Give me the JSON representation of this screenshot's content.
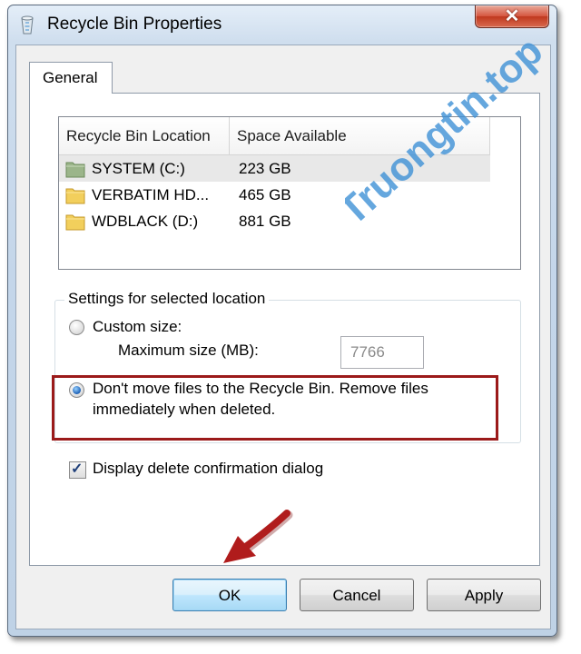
{
  "window": {
    "title": "Recycle Bin Properties",
    "close_glyph": "✕"
  },
  "tabs": [
    {
      "label": "General"
    }
  ],
  "list": {
    "columns": [
      "Recycle Bin Location",
      "Space Available"
    ],
    "rows": [
      {
        "name": "SYSTEM (C:)",
        "space": "223 GB",
        "icon": "drive-folder-icon",
        "selected": true
      },
      {
        "name": "VERBATIM HD...",
        "space": "465 GB",
        "icon": "folder-icon",
        "selected": false
      },
      {
        "name": "WDBLACK (D:)",
        "space": "881 GB",
        "icon": "folder-icon",
        "selected": false
      }
    ]
  },
  "settings": {
    "group_label": "Settings for selected location",
    "custom_size_label": "Custom size:",
    "max_size_label": "Maximum size (MB):",
    "max_size_value": "7766",
    "dont_move_line1": "Don't move files to the Recycle Bin. Remove files",
    "dont_move_line2": "immediately when deleted.",
    "custom_size_checked": false,
    "dont_move_checked": true,
    "confirm_label": "Display delete confirmation dialog",
    "confirm_checked": true
  },
  "buttons": {
    "ok": "OK",
    "cancel": "Cancel",
    "apply": "Apply"
  },
  "watermark": "Truongtin.top",
  "colors": {
    "highlight": "#9b1a1a",
    "arrow": "#b01c1c",
    "watermark": "#3b8fd6"
  }
}
